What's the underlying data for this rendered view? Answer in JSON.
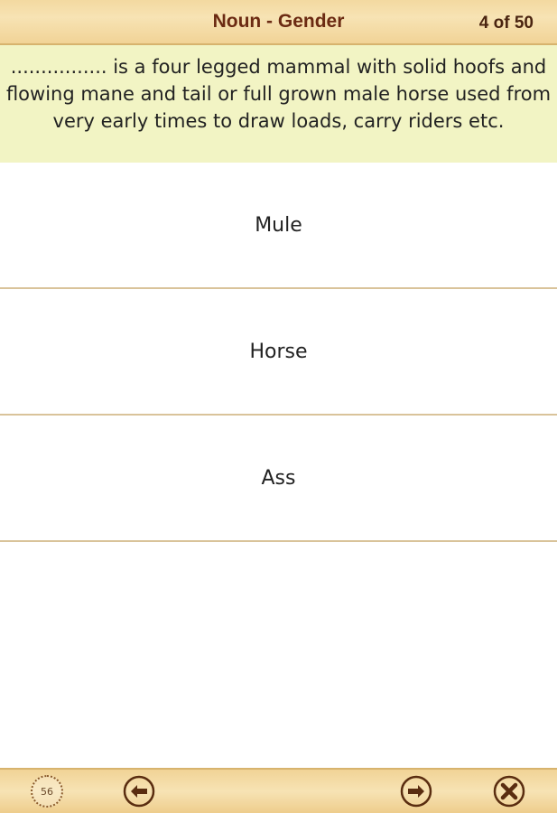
{
  "header": {
    "title": "Noun - Gender",
    "counter": "4 of 50"
  },
  "question": {
    "text": "................ is a four legged mammal with solid hoofs and flowing mane and tail or full grown male horse used from very early times to draw loads, carry riders etc."
  },
  "options": [
    {
      "label": "Mule"
    },
    {
      "label": "Horse"
    },
    {
      "label": "Ass"
    }
  ],
  "footer": {
    "timer_value": "56",
    "icons": [
      "timer-icon",
      "arrow-left-icon",
      "arrow-right-icon",
      "close-icon"
    ]
  },
  "colors": {
    "header_bg": "#f5dfaa",
    "title_text": "#6b2a12",
    "question_bg": "#f2f4c4",
    "divider": "#d9c39a",
    "icon_brown": "#5a2d10"
  }
}
